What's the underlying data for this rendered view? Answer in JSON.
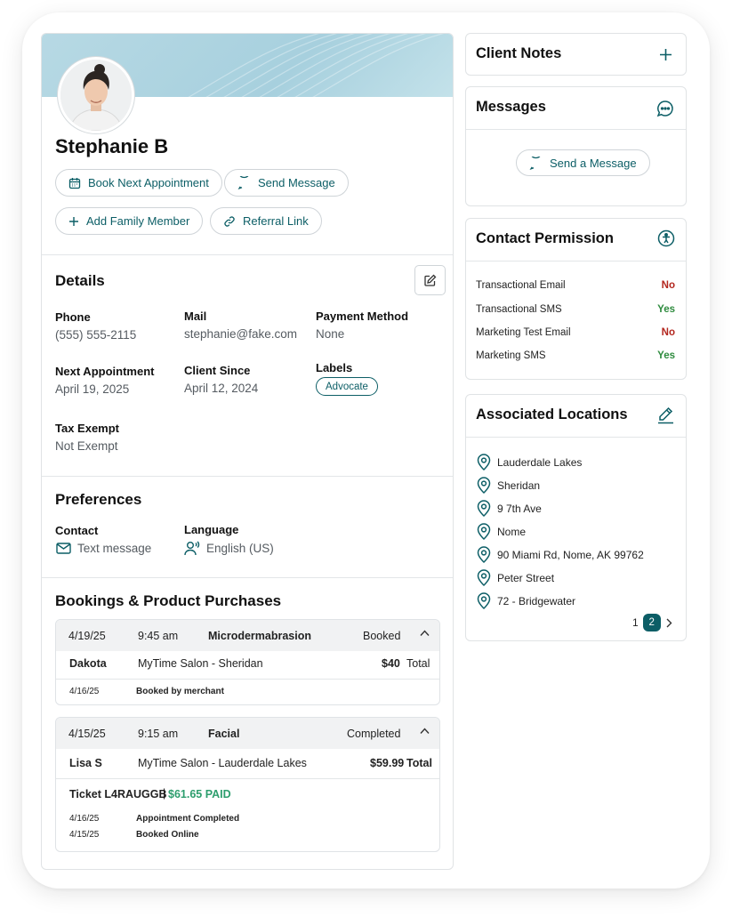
{
  "profile": {
    "name": "Stephanie B",
    "actions": {
      "book": "Book Next Appointment",
      "message": "Send Message",
      "family": "Add Family Member",
      "referral": "Referral Link"
    }
  },
  "details": {
    "title": "Details",
    "phone_label": "Phone",
    "phone": "(555) 555-2115",
    "mail_label": "Mail",
    "mail": "stephanie@fake.com",
    "payment_label": "Payment Method",
    "payment": "None",
    "next_label": "Next Appointment",
    "next": "April 19, 2025",
    "since_label": "Client Since",
    "since": "April 12, 2024",
    "labels_label": "Labels",
    "label_chip": "Advocate",
    "tax_label": "Tax Exempt",
    "tax": "Not Exempt"
  },
  "preferences": {
    "title": "Preferences",
    "contact_label": "Contact",
    "contact": "Text message",
    "language_label": "Language",
    "language": "English (US)"
  },
  "bookings": {
    "title": "Bookings & Product Purchases",
    "items": [
      {
        "date": "4/19/25",
        "time": "9:45 am",
        "service": "Microdermabrasion",
        "status": "Booked",
        "staff": "Dakota",
        "location": "MyTime Salon - Sheridan",
        "amount": "$40",
        "total_label": "Total",
        "history": [
          {
            "date": "4/16/25",
            "event": "Booked by merchant"
          }
        ]
      },
      {
        "date": "4/15/25",
        "time": "9:15 am",
        "service": "Facial",
        "status": "Completed",
        "staff": "Lisa S",
        "location": "MyTime Salon - Lauderdale Lakes",
        "amount": "$59.99",
        "total_label": "Total",
        "ticket": "Ticket L4RAUGGB",
        "paid": "$61.65 PAID",
        "history": [
          {
            "date": "4/16/25",
            "event": "Appointment Completed"
          },
          {
            "date": "4/15/25",
            "event": "Booked Online"
          }
        ]
      }
    ]
  },
  "client_notes": {
    "title": "Client Notes"
  },
  "messages": {
    "title": "Messages",
    "send": "Send a Message"
  },
  "contact_permission": {
    "title": "Contact Permission",
    "rows": [
      {
        "label": "Transactional Email",
        "value": "No"
      },
      {
        "label": "Transactional SMS",
        "value": "Yes"
      },
      {
        "label": "Marketing Test Email",
        "value": "No"
      },
      {
        "label": "Marketing SMS",
        "value": "Yes"
      }
    ]
  },
  "locations": {
    "title": "Associated Locations",
    "items": [
      "Lauderdale Lakes",
      "Sheridan",
      "9 7th Ave",
      "Nome",
      "90 Miami Rd, Nome, AK 99762",
      "Peter Street",
      "72 - Bridgewater"
    ],
    "pages": [
      "1",
      "2"
    ],
    "current_page": "2"
  },
  "colors": {
    "accent": "#0c5e66",
    "no": "#b3261e",
    "yes": "#2e8b3e",
    "paid": "#2e9e6e"
  }
}
